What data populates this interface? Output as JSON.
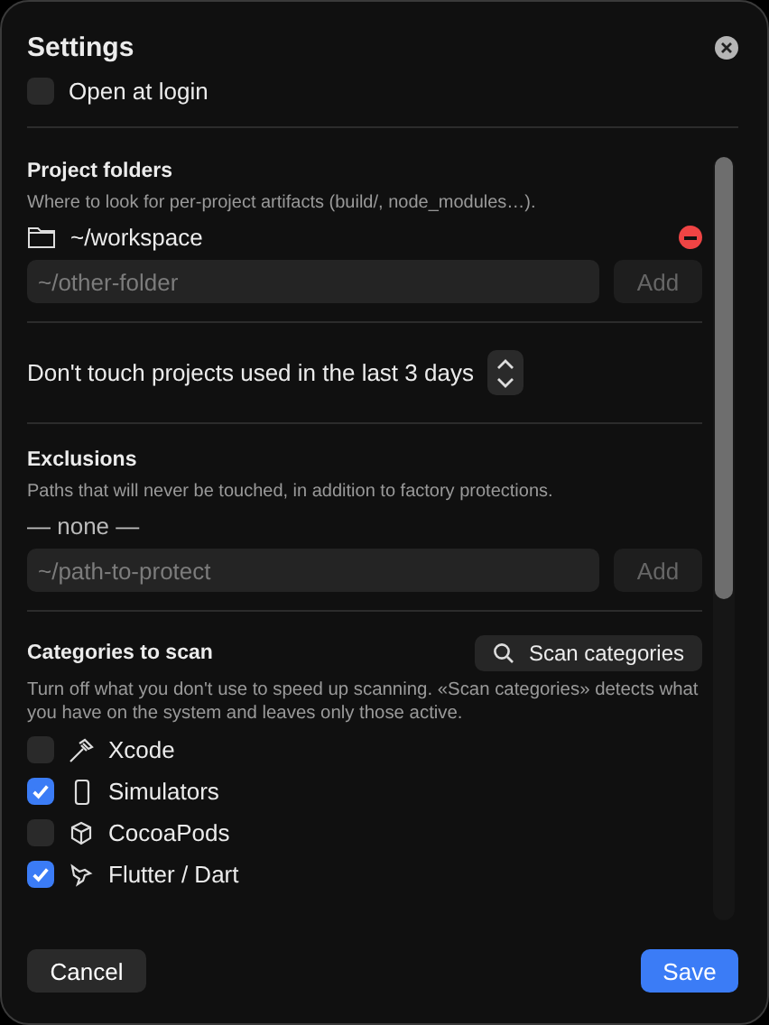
{
  "window": {
    "title": "Settings"
  },
  "open_at_login": {
    "label": "Open at login",
    "checked": false
  },
  "project_folders": {
    "title": "Project folders",
    "description": "Where to look for per-project artifacts (build/, node_modules…).",
    "folders": [
      "~/workspace"
    ],
    "input": {
      "placeholder": "~/other-folder"
    },
    "add_button": "Add"
  },
  "recent": {
    "label": "Don't touch projects used in the last 3 days"
  },
  "exclusions": {
    "title": "Exclusions",
    "description": "Paths that will never be touched, in addition to factory protections.",
    "empty": "— none —",
    "input": {
      "placeholder": "~/path-to-protect"
    },
    "add_button": "Add"
  },
  "categories": {
    "title": "Categories to scan",
    "scan_button": "Scan categories",
    "description": "Turn off what you don't use to speed up scanning. «Scan categories» detects what you have on the system and leaves only those active.",
    "items": [
      {
        "label": "Xcode",
        "checked": false
      },
      {
        "label": "Simulators",
        "checked": true
      },
      {
        "label": "CocoaPods",
        "checked": false
      },
      {
        "label": "Flutter / Dart",
        "checked": true
      }
    ]
  },
  "buttons": {
    "cancel": "Cancel",
    "save": "Save"
  }
}
